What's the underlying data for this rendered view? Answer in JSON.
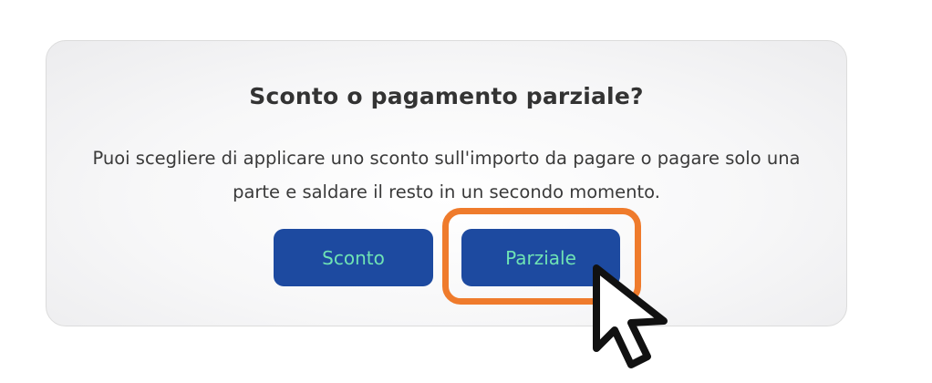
{
  "dialog": {
    "title": "Sconto o pagamento parziale?",
    "message": "Puoi scegliere di applicare uno sconto sull'importo da pagare o pagare solo una parte e saldare il resto in un secondo momento.",
    "buttons": {
      "sconto_label": "Sconto",
      "parziale_label": "Parziale"
    }
  },
  "colors": {
    "button_bg": "#1d4aa0",
    "button_text": "#6fe3b4",
    "highlight": "#ef7b2c"
  },
  "icons": {
    "cursor": "mouse-pointer-icon"
  }
}
